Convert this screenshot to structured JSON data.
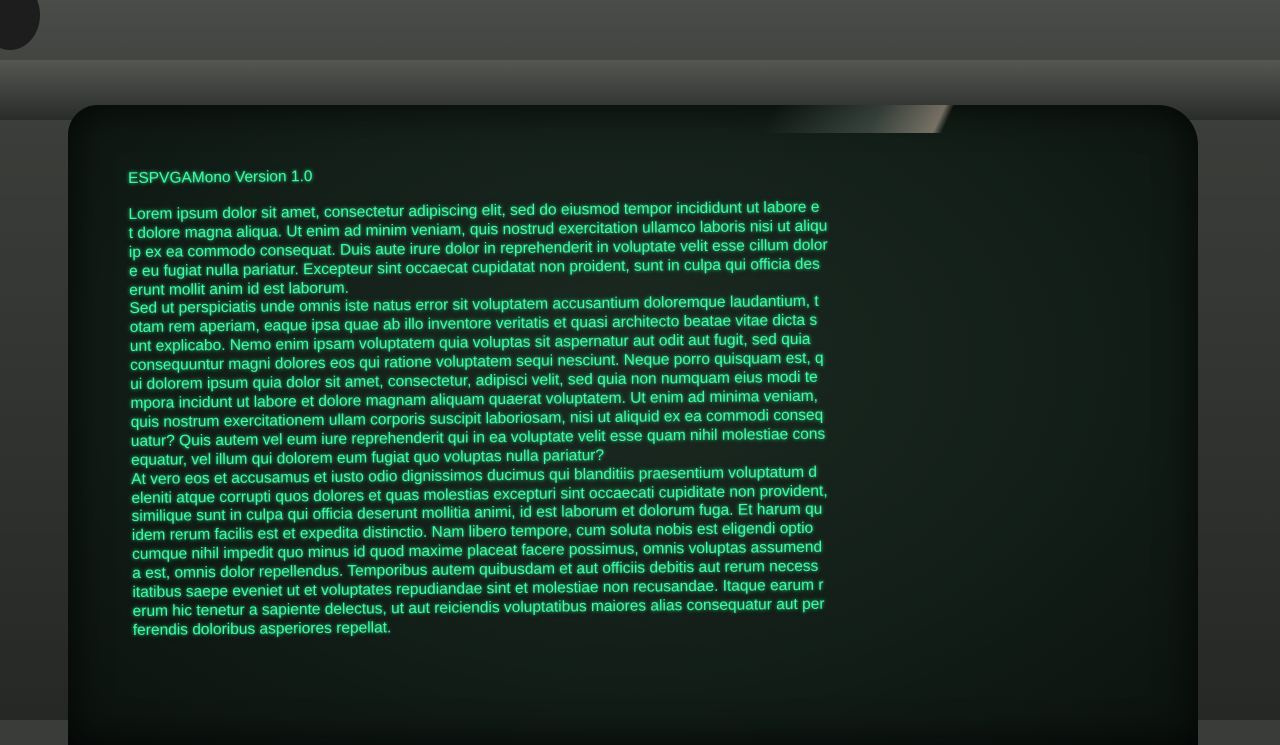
{
  "terminal": {
    "title": "ESPVGAMono Version 1.0",
    "lines": [
      "Lorem ipsum dolor sit amet, consectetur adipiscing elit, sed do eiusmod tempor incididunt ut labore e",
      "t dolore magna aliqua. Ut enim ad minim veniam, quis nostrud exercitation ullamco laboris nisi ut aliqu",
      "ip ex ea commodo consequat. Duis aute irure dolor in reprehenderit in voluptate velit esse cillum dolor",
      "e eu fugiat nulla pariatur. Excepteur sint occaecat cupidatat non proident, sunt in culpa qui officia des",
      "erunt mollit anim id est laborum.",
      "Sed ut perspiciatis unde omnis iste natus error sit voluptatem accusantium doloremque laudantium, t",
      "otam rem aperiam, eaque ipsa quae ab illo inventore veritatis et quasi architecto beatae vitae dicta s",
      "unt explicabo. Nemo enim ipsam voluptatem quia voluptas sit aspernatur aut odit aut fugit, sed quia",
      "consequuntur magni dolores eos qui ratione voluptatem sequi nesciunt. Neque porro quisquam est, q",
      "ui dolorem ipsum quia dolor sit amet, consectetur, adipisci velit, sed quia non numquam eius modi te",
      "mpora incidunt ut labore et dolore magnam aliquam quaerat voluptatem. Ut enim ad minima veniam,",
      "quis nostrum exercitationem ullam corporis suscipit laboriosam, nisi ut aliquid ex ea commodi conseq",
      "uatur? Quis autem vel eum iure reprehenderit qui in ea voluptate velit esse quam nihil molestiae cons",
      "equatur, vel illum qui dolorem eum fugiat quo voluptas nulla pariatur?",
      "At vero eos et accusamus et iusto odio dignissimos ducimus qui blanditiis praesentium voluptatum d",
      "eleniti atque corrupti quos dolores et quas molestias excepturi sint occaecati cupiditate non provident,",
      "similique sunt in culpa qui officia deserunt mollitia animi, id est laborum et dolorum fuga. Et harum qu",
      "idem rerum facilis est et expedita distinctio. Nam libero tempore, cum soluta nobis est eligendi optio",
      "cumque nihil impedit quo minus id quod maxime placeat facere possimus, omnis voluptas assumend",
      "a est, omnis dolor repellendus. Temporibus autem quibusdam et aut officiis debitis aut rerum necess",
      "itatibus saepe eveniet ut et voluptates repudiandae sint et molestiae non recusandae. Itaque earum r",
      "erum hic tenetur a sapiente delectus, ut aut reiciendis voluptatibus maiores alias consequatur aut per",
      "ferendis doloribus asperiores repellat."
    ]
  },
  "colors": {
    "phosphor_green": "#3dfca4",
    "screen_background": "#121d17",
    "bezel": "#3a3c3a"
  }
}
